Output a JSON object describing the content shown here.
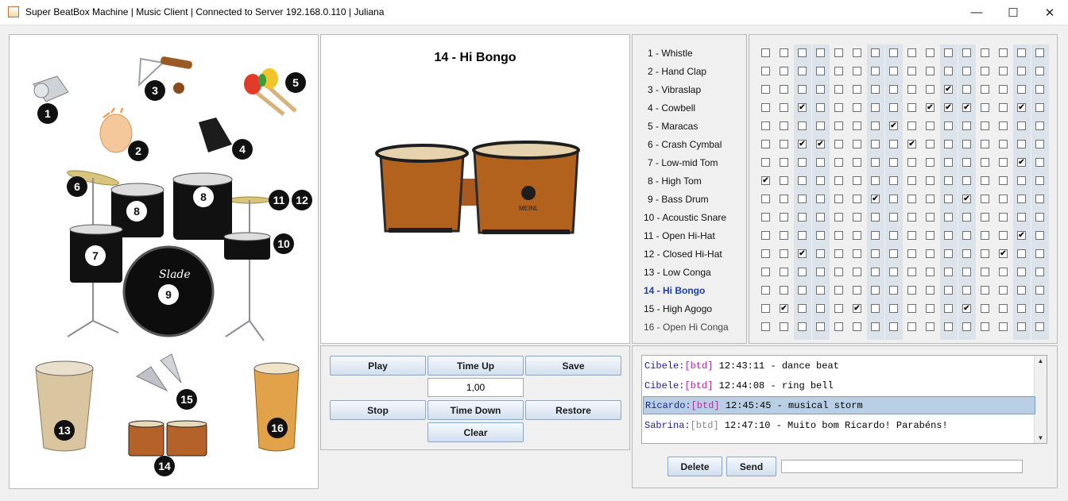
{
  "window": {
    "title": "Super BeatBox Machine | Music Client | Connected to Server 192.168.0.110 | Juliana",
    "minimize": "—",
    "maximize": "☐",
    "close": "✕"
  },
  "kit_numbers": [
    "1",
    "2",
    "3",
    "4",
    "5",
    "6",
    "7",
    "8",
    "8",
    "9",
    "10",
    "11",
    "12",
    "13",
    "14",
    "15",
    "16"
  ],
  "kit_brand": "Slade",
  "preview": {
    "title": "14 - Hi Bongo",
    "logo": "MEINL"
  },
  "controls": {
    "play": "Play",
    "time_up": "Time Up",
    "save": "Save",
    "tempo": "1,00",
    "stop": "Stop",
    "time_down": "Time Down",
    "restore": "Restore",
    "clear": "Clear"
  },
  "instruments": [
    "1 - Whistle",
    "2 - Hand Clap",
    "3 - Vibraslap",
    "4 - Cowbell",
    "5 - Maracas",
    "6 - Crash Cymbal",
    "7 - Low-mid Tom",
    "8 - High Tom",
    "9 - Bass Drum",
    "10 - Acoustic Snare",
    "11 - Open Hi-Hat",
    "12 - Closed Hi-Hat",
    "13 - Low Conga",
    "14 - Hi Bongo",
    "15 - High Agogo",
    "16 - Open Hi Conga"
  ],
  "selected_instrument": 13,
  "check_mark": "✔",
  "pattern": [
    [
      0,
      0,
      0,
      0,
      0,
      0,
      0,
      0,
      0,
      0,
      0,
      0,
      0,
      0,
      0,
      0
    ],
    [
      0,
      0,
      0,
      0,
      0,
      0,
      0,
      0,
      0,
      0,
      0,
      0,
      0,
      0,
      0,
      0
    ],
    [
      0,
      0,
      0,
      0,
      0,
      0,
      0,
      0,
      0,
      0,
      1,
      0,
      0,
      0,
      0,
      0
    ],
    [
      0,
      0,
      1,
      0,
      0,
      0,
      0,
      0,
      0,
      1,
      1,
      1,
      0,
      0,
      1,
      0
    ],
    [
      0,
      0,
      0,
      0,
      0,
      0,
      0,
      1,
      0,
      0,
      0,
      0,
      0,
      0,
      0,
      0
    ],
    [
      0,
      0,
      1,
      1,
      0,
      0,
      0,
      0,
      1,
      0,
      0,
      0,
      0,
      0,
      0,
      0
    ],
    [
      0,
      0,
      0,
      0,
      0,
      0,
      0,
      0,
      0,
      0,
      0,
      0,
      0,
      0,
      1,
      0
    ],
    [
      1,
      0,
      0,
      0,
      0,
      0,
      0,
      0,
      0,
      0,
      0,
      0,
      0,
      0,
      0,
      0
    ],
    [
      0,
      0,
      0,
      0,
      0,
      0,
      1,
      0,
      0,
      0,
      0,
      1,
      0,
      0,
      0,
      0
    ],
    [
      0,
      0,
      0,
      0,
      0,
      0,
      0,
      0,
      0,
      0,
      0,
      0,
      0,
      0,
      0,
      0
    ],
    [
      0,
      0,
      0,
      0,
      0,
      0,
      0,
      0,
      0,
      0,
      0,
      0,
      0,
      0,
      1,
      0
    ],
    [
      0,
      0,
      1,
      0,
      0,
      0,
      0,
      0,
      0,
      0,
      0,
      0,
      0,
      1,
      0,
      0
    ],
    [
      0,
      0,
      0,
      0,
      0,
      0,
      0,
      0,
      0,
      0,
      0,
      0,
      0,
      0,
      0,
      0
    ],
    [
      0,
      0,
      0,
      0,
      0,
      0,
      0,
      0,
      0,
      0,
      0,
      0,
      0,
      0,
      0,
      0
    ],
    [
      0,
      1,
      0,
      0,
      0,
      1,
      0,
      0,
      0,
      0,
      0,
      1,
      0,
      0,
      0,
      0
    ],
    [
      0,
      0,
      0,
      0,
      0,
      0,
      0,
      0,
      0,
      0,
      0,
      0,
      0,
      0,
      0,
      0
    ]
  ],
  "chat": [
    {
      "user": "Cibele:",
      "tag": "[btd]",
      "rest": " 12:43:11 - dance beat",
      "user_color": "#1d1d9a",
      "tag_color": "#b0309a"
    },
    {
      "user": "Cibele:",
      "tag": "[btd]",
      "rest": " 12:44:08 - ring bell",
      "user_color": "#1d1d9a",
      "tag_color": "#b0309a"
    },
    {
      "user": "Ricardo:",
      "tag": "[btd]",
      "rest": " 12:45:45 - musical storm",
      "user_color": "#1d1d9a",
      "tag_color": "#b0309a"
    },
    {
      "user": "Sabrina:",
      "tag": "[btd]",
      "rest": " 12:47:10 - Muito bom Ricardo! Parabéns!",
      "user_color": "#1d1d9a",
      "tag_color": "#888888"
    }
  ],
  "selected_chat": 2,
  "chat_buttons": {
    "delete": "Delete",
    "send": "Send"
  },
  "message_input": "",
  "scroll_up": "▲",
  "scroll_down": "▼"
}
